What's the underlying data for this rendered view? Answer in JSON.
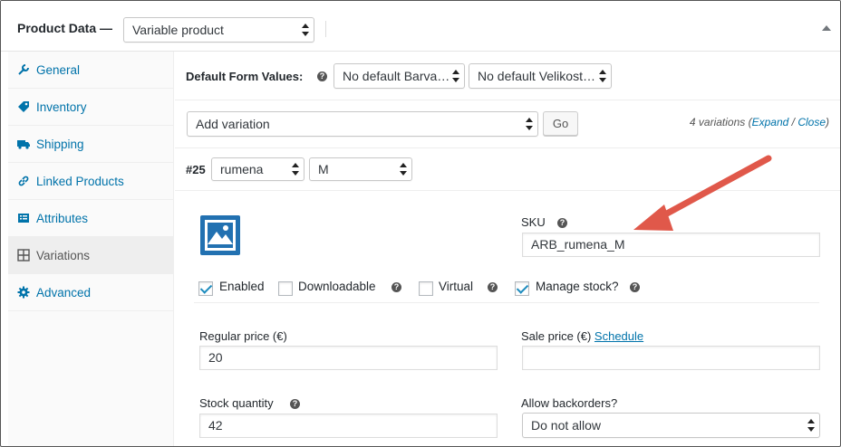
{
  "header": {
    "title": "Product Data —",
    "product_type": "Variable product"
  },
  "sidebar": {
    "items": [
      {
        "label": "General",
        "icon": "wrench-icon"
      },
      {
        "label": "Inventory",
        "icon": "tag-icon"
      },
      {
        "label": "Shipping",
        "icon": "truck-icon"
      },
      {
        "label": "Linked Products",
        "icon": "link-icon"
      },
      {
        "label": "Attributes",
        "icon": "list-icon"
      },
      {
        "label": "Variations",
        "icon": "grid-icon"
      },
      {
        "label": "Advanced",
        "icon": "gear-icon"
      }
    ],
    "active": "Variations"
  },
  "defaults": {
    "label": "Default Form Values:",
    "color_select": "No default Barva…",
    "size_select": "No default Velikost…"
  },
  "add_variation": {
    "select": "Add variation",
    "go": "Go",
    "count_text": "4 variations (",
    "expand": "Expand",
    "slash": " / ",
    "close": "Close",
    "close_paren": ")"
  },
  "variation": {
    "number": "#25",
    "color": "rumena",
    "size": "M",
    "sku_label": "SKU",
    "sku_value": "ARB_rumena_M",
    "checkboxes": {
      "enabled": {
        "label": "Enabled",
        "checked": true
      },
      "downloadable": {
        "label": "Downloadable",
        "checked": false
      },
      "virtual": {
        "label": "Virtual",
        "checked": false
      },
      "manage_stock": {
        "label": "Manage stock?",
        "checked": true
      }
    },
    "regular_price_label": "Regular price (€)",
    "regular_price": "20",
    "sale_price_label": "Sale price (€) ",
    "schedule": "Schedule",
    "sale_price": "",
    "stock_label": "Stock quantity",
    "stock": "42",
    "backorders_label": "Allow backorders?",
    "backorders": "Do not allow"
  },
  "colors": {
    "link": "#0073aa",
    "arrow": "#e0584a",
    "check": "#1e8cbe"
  }
}
